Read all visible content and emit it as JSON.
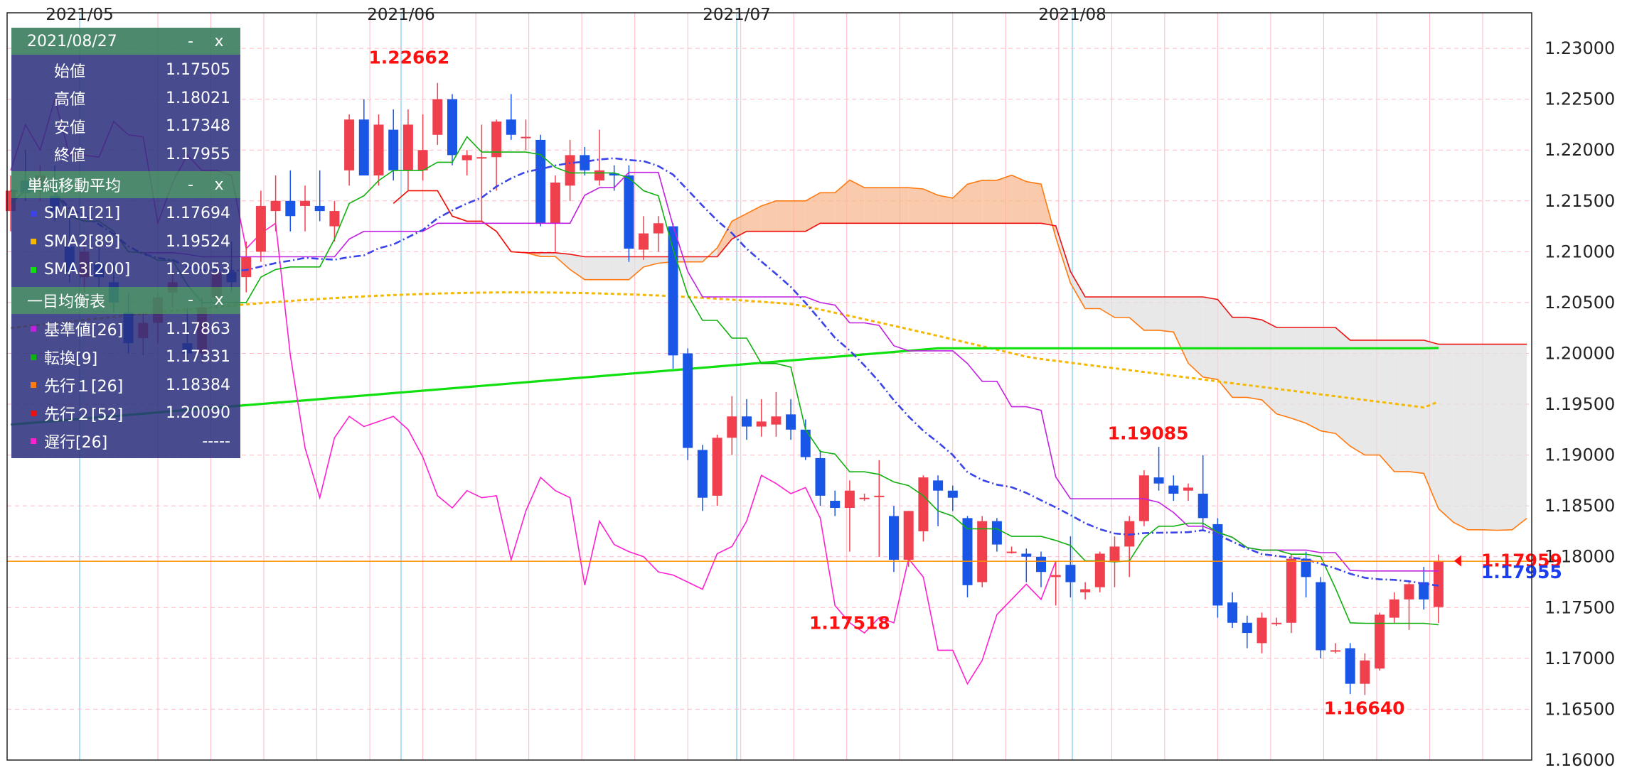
{
  "chart_data": {
    "type": "candlestick",
    "x_labels": [
      "2021/05",
      "2021/06",
      "2021/07",
      "2021/08"
    ],
    "y_ticks": [
      "1.23000",
      "1.22500",
      "1.22000",
      "1.21500",
      "1.21000",
      "1.20500",
      "1.20000",
      "1.19500",
      "1.19000",
      "1.18500",
      "1.18000",
      "1.17500",
      "1.17000",
      "1.16500",
      "1.16000"
    ],
    "ylim": [
      1.16,
      1.2335
    ],
    "grid": true,
    "candles": [
      {
        "o": 1.214,
        "h": 1.2175,
        "l": 1.212,
        "c": 1.216
      },
      {
        "o": 1.217,
        "h": 1.22,
        "l": 1.215,
        "c": 1.2158
      },
      {
        "o": 1.2165,
        "h": 1.2185,
        "l": 1.215,
        "c": 1.2175
      },
      {
        "o": 1.2155,
        "h": 1.2185,
        "l": 1.213,
        "c": 1.214
      },
      {
        "o": 1.2105,
        "h": 1.214,
        "l": 1.207,
        "c": 1.208
      },
      {
        "o": 1.2075,
        "h": 1.211,
        "l": 1.206,
        "c": 1.21
      },
      {
        "o": 1.2088,
        "h": 1.211,
        "l": 1.2065,
        "c": 1.2075
      },
      {
        "o": 1.207,
        "h": 1.209,
        "l": 1.204,
        "c": 1.205
      },
      {
        "o": 1.204,
        "h": 1.206,
        "l": 1.2,
        "c": 1.201
      },
      {
        "o": 1.2015,
        "h": 1.204,
        "l": 1.1998,
        "c": 1.203
      },
      {
        "o": 1.203,
        "h": 1.206,
        "l": 1.201,
        "c": 1.2055
      },
      {
        "o": 1.206,
        "h": 1.208,
        "l": 1.2045,
        "c": 1.207
      },
      {
        "o": 1.201,
        "h": 1.2045,
        "l": 1.1995,
        "c": 1.2
      },
      {
        "o": 1.2,
        "h": 1.2055,
        "l": 1.199,
        "c": 1.2045
      },
      {
        "o": 1.2055,
        "h": 1.209,
        "l": 1.2045,
        "c": 1.208
      },
      {
        "o": 1.208,
        "h": 1.211,
        "l": 1.206,
        "c": 1.207
      },
      {
        "o": 1.2075,
        "h": 1.211,
        "l": 1.206,
        "c": 1.2095
      },
      {
        "o": 1.21,
        "h": 1.216,
        "l": 1.209,
        "c": 1.2145
      },
      {
        "o": 1.214,
        "h": 1.2175,
        "l": 1.212,
        "c": 1.215
      },
      {
        "o": 1.215,
        "h": 1.218,
        "l": 1.212,
        "c": 1.2135
      },
      {
        "o": 1.2145,
        "h": 1.2165,
        "l": 1.212,
        "c": 1.215
      },
      {
        "o": 1.2145,
        "h": 1.218,
        "l": 1.213,
        "c": 1.214
      },
      {
        "o": 1.2125,
        "h": 1.215,
        "l": 1.211,
        "c": 1.214
      },
      {
        "o": 1.218,
        "h": 1.2235,
        "l": 1.2165,
        "c": 1.223
      },
      {
        "o": 1.223,
        "h": 1.225,
        "l": 1.218,
        "c": 1.2175
      },
      {
        "o": 1.2175,
        "h": 1.2235,
        "l": 1.2165,
        "c": 1.2225
      },
      {
        "o": 1.222,
        "h": 1.224,
        "l": 1.217,
        "c": 1.218
      },
      {
        "o": 1.218,
        "h": 1.224,
        "l": 1.216,
        "c": 1.2225
      },
      {
        "o": 1.218,
        "h": 1.2235,
        "l": 1.217,
        "c": 1.22
      },
      {
        "o": 1.2215,
        "h": 1.2266,
        "l": 1.2205,
        "c": 1.225
      },
      {
        "o": 1.225,
        "h": 1.2255,
        "l": 1.2185,
        "c": 1.2195
      },
      {
        "o": 1.219,
        "h": 1.22,
        "l": 1.2175,
        "c": 1.2195
      },
      {
        "o": 1.2193,
        "h": 1.2225,
        "l": 1.213,
        "c": 1.2193
      },
      {
        "o": 1.2193,
        "h": 1.223,
        "l": 1.216,
        "c": 1.2228
      },
      {
        "o": 1.223,
        "h": 1.2255,
        "l": 1.221,
        "c": 1.2215
      },
      {
        "o": 1.2213,
        "h": 1.223,
        "l": 1.22,
        "c": 1.2213
      },
      {
        "o": 1.221,
        "h": 1.2215,
        "l": 1.2125,
        "c": 1.2128
      },
      {
        "o": 1.2128,
        "h": 1.2175,
        "l": 1.21,
        "c": 1.2168
      },
      {
        "o": 1.2165,
        "h": 1.221,
        "l": 1.215,
        "c": 1.2195
      },
      {
        "o": 1.2195,
        "h": 1.2203,
        "l": 1.2175,
        "c": 1.218
      },
      {
        "o": 1.217,
        "h": 1.222,
        "l": 1.2165,
        "c": 1.218
      },
      {
        "o": 1.2177,
        "h": 1.2185,
        "l": 1.216,
        "c": 1.2175
      },
      {
        "o": 1.2175,
        "h": 1.2185,
        "l": 1.209,
        "c": 1.2103
      },
      {
        "o": 1.2102,
        "h": 1.2135,
        "l": 1.2092,
        "c": 1.2118
      },
      {
        "o": 1.2118,
        "h": 1.2135,
        "l": 1.21,
        "c": 1.2128
      },
      {
        "o": 1.2125,
        "h": 1.2128,
        "l": 1.1985,
        "c": 1.1998
      },
      {
        "o": 1.2,
        "h": 1.2005,
        "l": 1.1895,
        "c": 1.1907
      },
      {
        "o": 1.1905,
        "h": 1.191,
        "l": 1.1845,
        "c": 1.1858
      },
      {
        "o": 1.186,
        "h": 1.192,
        "l": 1.185,
        "c": 1.1917
      },
      {
        "o": 1.1917,
        "h": 1.1958,
        "l": 1.19,
        "c": 1.1938
      },
      {
        "o": 1.1938,
        "h": 1.1955,
        "l": 1.1915,
        "c": 1.1928
      },
      {
        "o": 1.1928,
        "h": 1.1955,
        "l": 1.1918,
        "c": 1.1933
      },
      {
        "o": 1.193,
        "h": 1.1962,
        "l": 1.1918,
        "c": 1.1938
      },
      {
        "o": 1.194,
        "h": 1.1955,
        "l": 1.1915,
        "c": 1.1925
      },
      {
        "o": 1.1925,
        "h": 1.1935,
        "l": 1.1895,
        "c": 1.1898
      },
      {
        "o": 1.1897,
        "h": 1.1905,
        "l": 1.185,
        "c": 1.186
      },
      {
        "o": 1.1855,
        "h": 1.1865,
        "l": 1.184,
        "c": 1.1848
      },
      {
        "o": 1.1848,
        "h": 1.1875,
        "l": 1.1805,
        "c": 1.1865
      },
      {
        "o": 1.1858,
        "h": 1.1862,
        "l": 1.1855,
        "c": 1.1858
      },
      {
        "o": 1.186,
        "h": 1.1895,
        "l": 1.18,
        "c": 1.186
      },
      {
        "o": 1.184,
        "h": 1.185,
        "l": 1.1785,
        "c": 1.1797
      },
      {
        "o": 1.1797,
        "h": 1.1845,
        "l": 1.179,
        "c": 1.1845
      },
      {
        "o": 1.1825,
        "h": 1.188,
        "l": 1.1815,
        "c": 1.1878
      },
      {
        "o": 1.1875,
        "h": 1.188,
        "l": 1.183,
        "c": 1.1865
      },
      {
        "o": 1.1865,
        "h": 1.187,
        "l": 1.1845,
        "c": 1.1858
      },
      {
        "o": 1.1838,
        "h": 1.184,
        "l": 1.176,
        "c": 1.1772
      },
      {
        "o": 1.1775,
        "h": 1.184,
        "l": 1.177,
        "c": 1.1835
      },
      {
        "o": 1.1835,
        "h": 1.1838,
        "l": 1.1805,
        "c": 1.1812
      },
      {
        "o": 1.1805,
        "h": 1.181,
        "l": 1.1803,
        "c": 1.1805
      },
      {
        "o": 1.1803,
        "h": 1.1808,
        "l": 1.1775,
        "c": 1.18
      },
      {
        "o": 1.18,
        "h": 1.1805,
        "l": 1.177,
        "c": 1.1785
      },
      {
        "o": 1.178,
        "h": 1.1795,
        "l": 1.1752,
        "c": 1.1782
      },
      {
        "o": 1.1792,
        "h": 1.182,
        "l": 1.176,
        "c": 1.1775
      },
      {
        "o": 1.1765,
        "h": 1.1775,
        "l": 1.1758,
        "c": 1.1768
      },
      {
        "o": 1.177,
        "h": 1.1805,
        "l": 1.1765,
        "c": 1.1803
      },
      {
        "o": 1.1795,
        "h": 1.182,
        "l": 1.177,
        "c": 1.181
      },
      {
        "o": 1.181,
        "h": 1.184,
        "l": 1.178,
        "c": 1.1835
      },
      {
        "o": 1.1835,
        "h": 1.1885,
        "l": 1.183,
        "c": 1.188
      },
      {
        "o": 1.1878,
        "h": 1.1908,
        "l": 1.1865,
        "c": 1.1872
      },
      {
        "o": 1.187,
        "h": 1.188,
        "l": 1.1855,
        "c": 1.1862
      },
      {
        "o": 1.1865,
        "h": 1.1872,
        "l": 1.1855,
        "c": 1.1868
      },
      {
        "o": 1.1862,
        "h": 1.19,
        "l": 1.1825,
        "c": 1.1838
      },
      {
        "o": 1.1832,
        "h": 1.1838,
        "l": 1.174,
        "c": 1.1752
      },
      {
        "o": 1.1755,
        "h": 1.1765,
        "l": 1.173,
        "c": 1.1735
      },
      {
        "o": 1.1735,
        "h": 1.1742,
        "l": 1.171,
        "c": 1.1725
      },
      {
        "o": 1.1715,
        "h": 1.1745,
        "l": 1.1705,
        "c": 1.174
      },
      {
        "o": 1.1735,
        "h": 1.174,
        "l": 1.1732,
        "c": 1.1735
      },
      {
        "o": 1.1735,
        "h": 1.1802,
        "l": 1.1725,
        "c": 1.1798
      },
      {
        "o": 1.1798,
        "h": 1.1805,
        "l": 1.176,
        "c": 1.178
      },
      {
        "o": 1.1775,
        "h": 1.178,
        "l": 1.17,
        "c": 1.1708
      },
      {
        "o": 1.1708,
        "h": 1.1715,
        "l": 1.1705,
        "c": 1.1708
      },
      {
        "o": 1.171,
        "h": 1.1715,
        "l": 1.1665,
        "c": 1.1675
      },
      {
        "o": 1.1675,
        "h": 1.1705,
        "l": 1.1664,
        "c": 1.1698
      },
      {
        "o": 1.169,
        "h": 1.1745,
        "l": 1.1688,
        "c": 1.1743
      },
      {
        "o": 1.174,
        "h": 1.1765,
        "l": 1.1735,
        "c": 1.1758
      },
      {
        "o": 1.1758,
        "h": 1.1775,
        "l": 1.1728,
        "c": 1.1773
      },
      {
        "o": 1.1775,
        "h": 1.179,
        "l": 1.1748,
        "c": 1.1758
      },
      {
        "o": 1.17505,
        "h": 1.18021,
        "l": 1.17348,
        "c": 1.17955
      }
    ],
    "annotations": [
      {
        "text": "1.22662",
        "price": 1.22662
      },
      {
        "text": "1.19085",
        "price": 1.19085
      },
      {
        "text": "1.17518",
        "price": 1.17518
      },
      {
        "text": "1.16640",
        "price": 1.1664
      },
      {
        "text": "1.17959",
        "price": 1.17959
      },
      {
        "text": "1.17955",
        "price": 1.17955
      }
    ],
    "colors": {
      "up": "#f0404e",
      "down": "#1a56e6",
      "sma1": "#3a44e8",
      "sma2": "#f5b800",
      "sma3": "#10e010",
      "kijun": "#c020e0",
      "tenkan": "#10b010",
      "senkou1": "#ff7a10",
      "senkou2": "#ee1010",
      "chikou": "#ff20d0",
      "cloud_up": "#f8b890",
      "cloud_down": "#e0e0e0",
      "price_line": "#ff8c00",
      "grid_h": "#ffb8c4",
      "grid_v": "#ffb8c4",
      "month_line": "#7cc8f0",
      "label_red": "#ff1010",
      "label_blue": "#1a3ef0"
    }
  },
  "panel": {
    "ohlc_header": "2021/08/27",
    "ohlc": [
      {
        "label": "始値",
        "value": "1.17505"
      },
      {
        "label": "高値",
        "value": "1.18021"
      },
      {
        "label": "安値",
        "value": "1.17348"
      },
      {
        "label": "終値",
        "value": "1.17955"
      }
    ],
    "sma_header": "単純移動平均",
    "sma": [
      {
        "label": "SMA1[21]",
        "value": "1.17694",
        "color": "#3a44e8"
      },
      {
        "label": "SMA2[89]",
        "value": "1.19524",
        "color": "#f5b800"
      },
      {
        "label": "SMA3[200]",
        "value": "1.20053",
        "color": "#10e010"
      }
    ],
    "ichimoku_header": "一目均衡表",
    "ichimoku": [
      {
        "label": "基準値[26]",
        "value": "1.17863",
        "color": "#c020e0"
      },
      {
        "label": "転換[9]",
        "value": "1.17331",
        "color": "#10b010"
      },
      {
        "label": "先行１[26]",
        "value": "1.18384",
        "color": "#ff7a10"
      },
      {
        "label": "先行２[52]",
        "value": "1.20090",
        "color": "#ee1010"
      },
      {
        "label": "遅行[26]",
        "value": "-----",
        "color": "#ff20d0"
      }
    ],
    "minimize": "-",
    "close": "x"
  }
}
